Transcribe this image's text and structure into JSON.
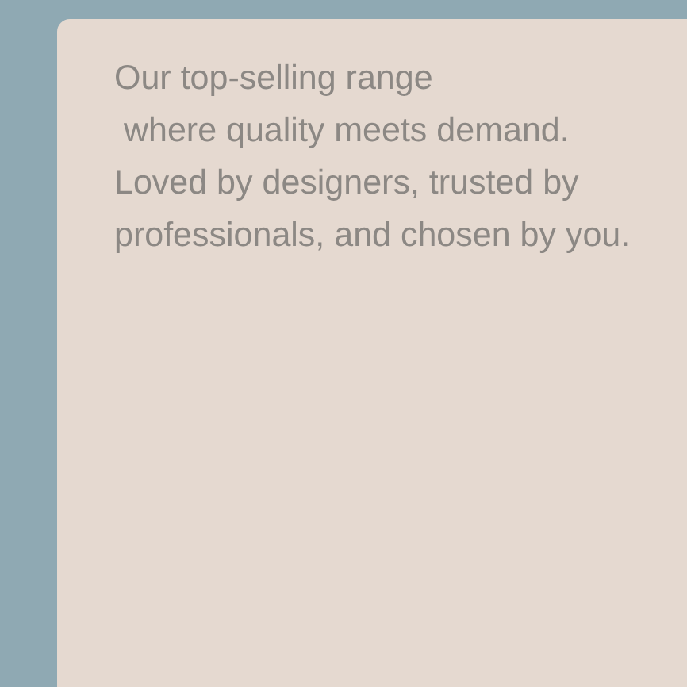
{
  "card": {
    "text": "Our top-selling range\n where quality meets demand. Loved by designers, trusted by professionals, and chosen by you."
  }
}
